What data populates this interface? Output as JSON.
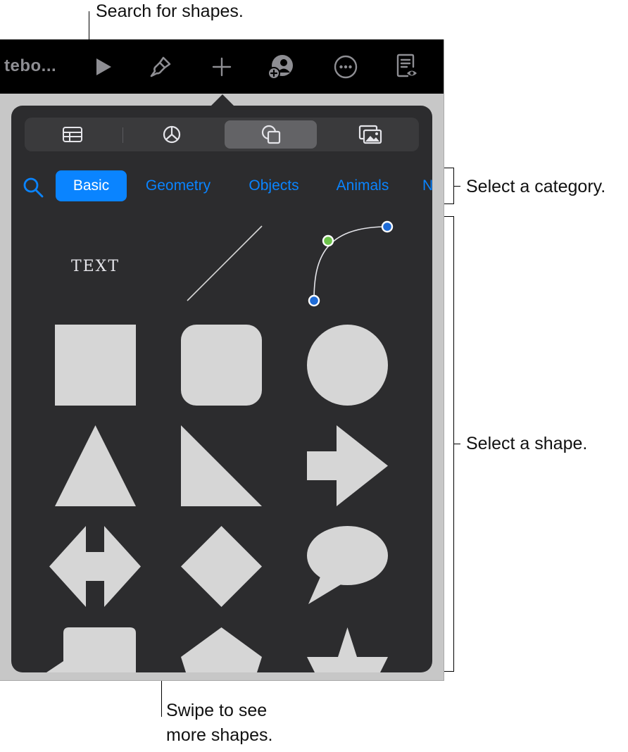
{
  "annotations": {
    "search": "Search for shapes.",
    "category": "Select a category.",
    "shape": "Select a shape.",
    "swipe_line1": "Swipe to see",
    "swipe_line2": "more shapes."
  },
  "toolbar": {
    "title": "tebo...",
    "icons": [
      "play-icon",
      "paintbrush-icon",
      "plus-icon",
      "collaborate-icon",
      "more-icon",
      "reader-view-icon"
    ]
  },
  "segments": [
    {
      "icon": "table-icon",
      "selected": false
    },
    {
      "icon": "chart-icon",
      "selected": false
    },
    {
      "icon": "shapes-icon",
      "selected": true
    },
    {
      "icon": "media-icon",
      "selected": false
    }
  ],
  "categories": [
    {
      "label": "Basic",
      "selected": true
    },
    {
      "label": "Geometry",
      "selected": false
    },
    {
      "label": "Objects",
      "selected": false
    },
    {
      "label": "Animals",
      "selected": false
    },
    {
      "label": "N",
      "selected": false
    }
  ],
  "shapes": {
    "text_label": "TEXT",
    "items": [
      "text-box",
      "line",
      "curve",
      "square",
      "rounded-square",
      "circle",
      "triangle",
      "right-triangle",
      "arrow",
      "double-arrow",
      "diamond",
      "speech-bubble",
      "callout-square",
      "pentagon",
      "star"
    ]
  },
  "colors": {
    "accent": "#0a84ff",
    "popover_bg": "#2c2c2e",
    "shape_fill": "#d6d6d6",
    "curve_handle_blue": "#1e6bd6",
    "curve_handle_green": "#6cc24a"
  }
}
